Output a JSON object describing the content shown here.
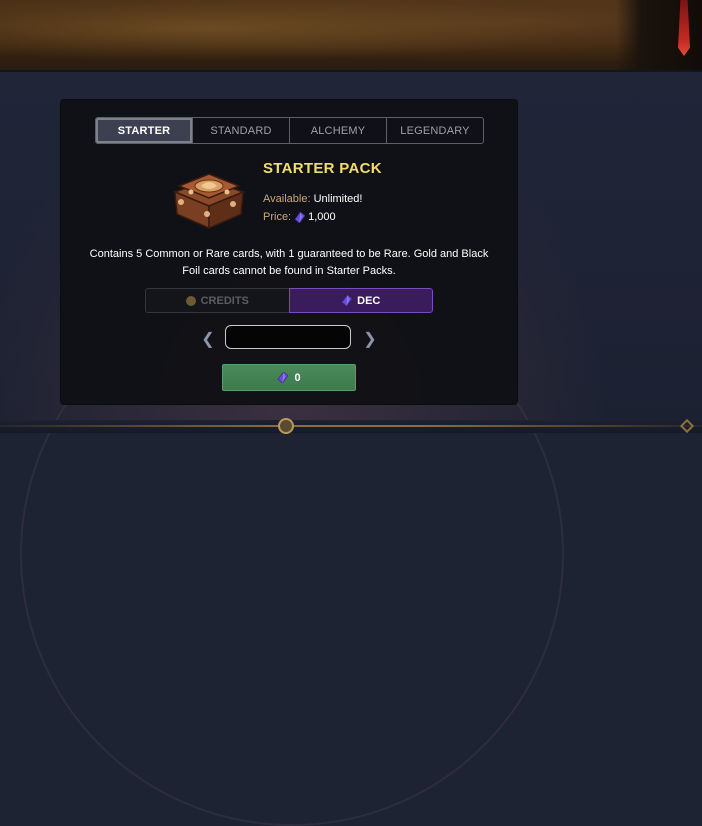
{
  "tabs": [
    {
      "label": "STARTER",
      "active": true
    },
    {
      "label": "STANDARD",
      "active": false
    },
    {
      "label": "ALCHEMY",
      "active": false
    },
    {
      "label": "LEGENDARY",
      "active": false
    }
  ],
  "pack": {
    "title": "STARTER PACK",
    "available_label": "Available:",
    "available_value": "Unlimited!",
    "price_label": "Price:",
    "price_icon": "dec-gem-icon",
    "price_value": "1,000",
    "description": "Contains 5 Common or Rare cards, with 1 guaranteed to be Rare. Gold and Black Foil cards cannot be found in Starter Packs."
  },
  "currency": {
    "credits_label": "CREDITS",
    "dec_label": "DEC",
    "selected": "DEC"
  },
  "quantity": {
    "value": ""
  },
  "buy": {
    "total": "0",
    "icon": "dec-gem-icon"
  },
  "colors": {
    "title": "#f2dd6a",
    "label": "#c9a77a",
    "dec_selected": "#3a1b5c",
    "buy_button": "#4a8a5a"
  }
}
